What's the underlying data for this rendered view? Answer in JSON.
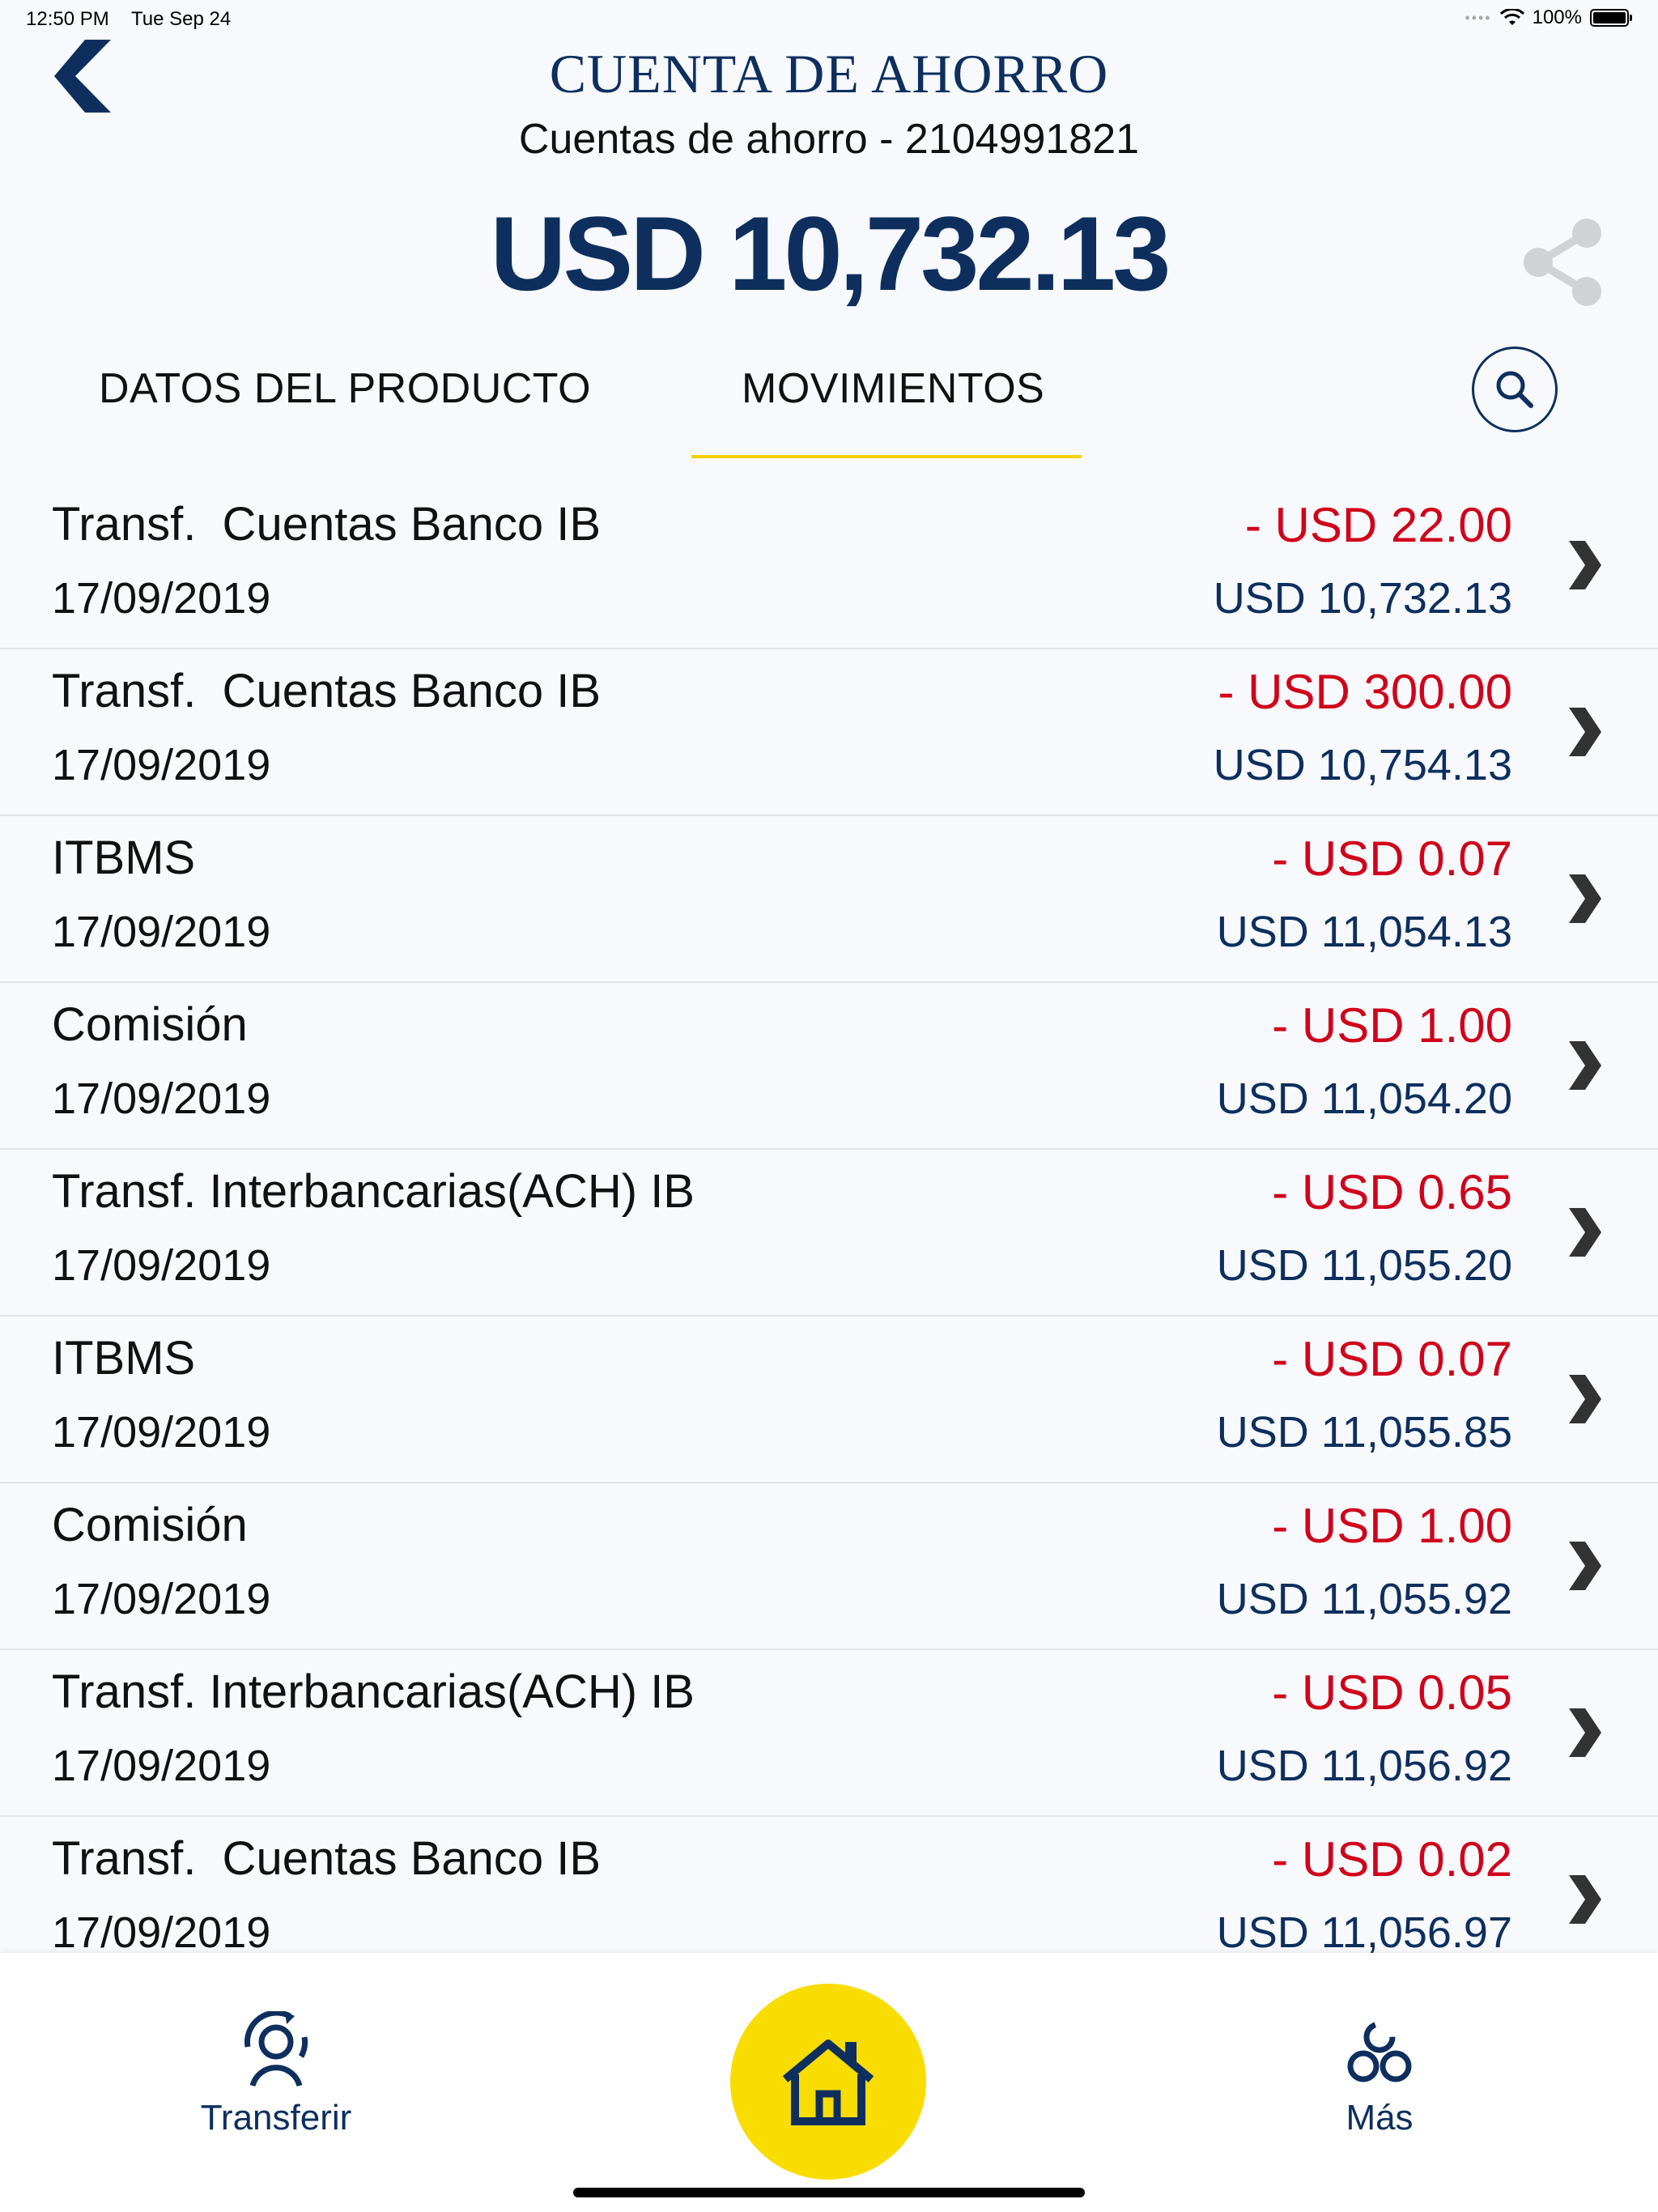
{
  "status_bar": {
    "time": "12:50 PM",
    "date": "Tue Sep 24",
    "battery": "100%"
  },
  "header": {
    "title": "CUENTA DE AHORRO",
    "subtitle": "Cuentas de ahorro - 2104991821",
    "balance": "USD 10,732.13"
  },
  "tabs": [
    {
      "label": "DATOS DEL PRODUCTO"
    },
    {
      "label": "MOVIMIENTOS",
      "selected": true
    }
  ],
  "movements": [
    {
      "description": "Transf.  Cuentas Banco IB",
      "date": "17/09/2019",
      "amount": "- USD 22.00",
      "running_balance": "USD 10,732.13"
    },
    {
      "description": "Transf.  Cuentas Banco IB",
      "date": "17/09/2019",
      "amount": "- USD 300.00",
      "running_balance": "USD 10,754.13"
    },
    {
      "description": "ITBMS",
      "date": "17/09/2019",
      "amount": "- USD 0.07",
      "running_balance": "USD 11,054.13"
    },
    {
      "description": "Comisión",
      "date": "17/09/2019",
      "amount": "- USD 1.00",
      "running_balance": "USD 11,054.20"
    },
    {
      "description": "Transf. Interbancarias(ACH) IB",
      "date": "17/09/2019",
      "amount": "- USD 0.65",
      "running_balance": "USD 11,055.20"
    },
    {
      "description": "ITBMS",
      "date": "17/09/2019",
      "amount": "- USD 0.07",
      "running_balance": "USD 11,055.85"
    },
    {
      "description": "Comisión",
      "date": "17/09/2019",
      "amount": "- USD 1.00",
      "running_balance": "USD 11,055.92"
    },
    {
      "description": "Transf. Interbancarias(ACH) IB",
      "date": "17/09/2019",
      "amount": "- USD 0.05",
      "running_balance": "USD 11,056.92"
    },
    {
      "description": "Transf.  Cuentas Banco IB",
      "date": "17/09/2019",
      "amount": "- USD 0.02",
      "running_balance": "USD 11,056.97"
    }
  ],
  "bottom_nav": {
    "transferir_label": "Transferir",
    "mas_label": "Más"
  },
  "colors": {
    "primary": "#0e2f5e",
    "accent": "#f9dc00",
    "debit": "#d0021b"
  },
  "icons": {
    "back": "back-arrow-icon",
    "share": "share-icon",
    "search": "search-icon",
    "row": "chevron-right-icon",
    "transferir": "transfer-user-icon",
    "home": "home-icon",
    "mas": "more-icon"
  }
}
